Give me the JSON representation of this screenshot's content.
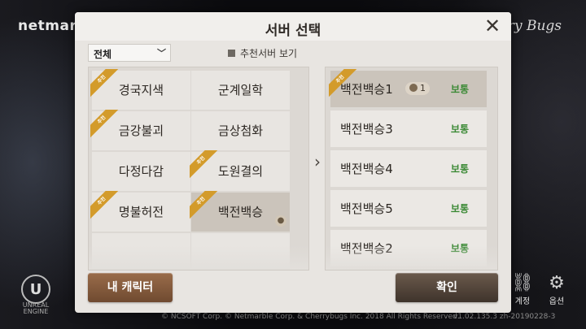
{
  "background": {
    "brand_left": "netmarb",
    "brand_right": "rry Bugs",
    "copyright": "© NCSOFT Corp. © Netmarble Corp. & Cherrybugs Inc. 2018 All Rights Reserved.",
    "version": "v1.02.135.3  zh-20190228-3",
    "unreal_text": "UNREAL ENGINE",
    "account_label": "계정",
    "options_label": "옵션"
  },
  "dialog": {
    "title": "서버 선택",
    "close_symbol": "✕",
    "filter": {
      "selected": "전체"
    },
    "recommended_toggle_label": "추천서버 보기",
    "recommended_badge": "추천",
    "arrow_symbol": "›"
  },
  "server_groups": [
    {
      "name": "경국지색",
      "recommended": true,
      "selected": false,
      "has_character": false
    },
    {
      "name": "군계일학",
      "recommended": false,
      "selected": false,
      "has_character": false
    },
    {
      "name": "금강불괴",
      "recommended": true,
      "selected": false,
      "has_character": false
    },
    {
      "name": "금상첨화",
      "recommended": false,
      "selected": false,
      "has_character": false
    },
    {
      "name": "다정다감",
      "recommended": false,
      "selected": false,
      "has_character": false
    },
    {
      "name": "도원결의",
      "recommended": true,
      "selected": false,
      "has_character": false
    },
    {
      "name": "명불허전",
      "recommended": true,
      "selected": false,
      "has_character": false
    },
    {
      "name": "백전백승",
      "recommended": true,
      "selected": true,
      "has_character": true
    }
  ],
  "servers": [
    {
      "name": "백전백승1",
      "status": "보통",
      "recommended": true,
      "selected": true,
      "characters": "1"
    },
    {
      "name": "백전백승3",
      "status": "보통",
      "recommended": false,
      "selected": false,
      "characters": ""
    },
    {
      "name": "백전백승4",
      "status": "보통",
      "recommended": false,
      "selected": false,
      "characters": ""
    },
    {
      "name": "백전백승5",
      "status": "보통",
      "recommended": false,
      "selected": false,
      "characters": ""
    },
    {
      "name": "백전백승2",
      "status": "보통",
      "recommended": false,
      "selected": false,
      "characters": ""
    }
  ],
  "buttons": {
    "my_character": "내 캐릭터",
    "confirm": "확인"
  },
  "colors": {
    "status_normal": "#3c8a36",
    "ribbon": "#d39b2b",
    "selected_cell": "#cbc4bb"
  }
}
